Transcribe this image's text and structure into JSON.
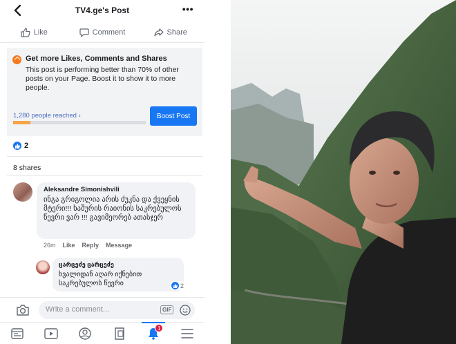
{
  "nav": {
    "title": "TV4.ge's Post",
    "more": "•••"
  },
  "actions": {
    "like": "Like",
    "comment": "Comment",
    "share": "Share"
  },
  "boost": {
    "headline": "Get more Likes, Comments and Shares",
    "body": "This post is performing better than 70% of other posts on your Page. Boost it to show it to more people.",
    "reach_text": "1,280 people reached ›",
    "reach_progress": 0.13,
    "button": "Boost Post"
  },
  "reactions": {
    "count": "2"
  },
  "shares": "8 shares",
  "comment": {
    "author": "Aleksandre Simonishvili",
    "text": "ინგა გრიგოლია არის ძუკნა და ქვეყნის მტერი!!! ხაშურის რაიონის საკრებულოს წევრი ვარ !!! გავიმეორებ ათასჯერ",
    "time": "26m",
    "like": "Like",
    "reply": "Reply",
    "message": "Message"
  },
  "reply": {
    "author": "ცარცეძე ცარცეძე",
    "text": "ხვალიდან აღარ იქნებით საკრებულოს წევრი",
    "likes": "2"
  },
  "composer": {
    "placeholder": "Write a comment...",
    "gif": "GIF"
  },
  "tabbar": {
    "notifications_badge": "1"
  },
  "colors": {
    "fb_blue": "#1877f2",
    "progress": "#f6a34a",
    "badge": "#e41e3f"
  }
}
